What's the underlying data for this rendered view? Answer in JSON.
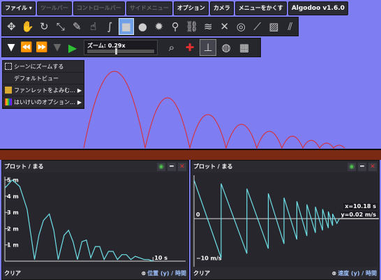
{
  "menubar": {
    "file": "ファイル ▾",
    "toolbar": "ツールバー",
    "control": "コントロールバー",
    "side": "サイドメニュー",
    "options": "オプション",
    "camera": "カメラ",
    "hide_menu": "メニューをかくす",
    "brand": "Algodoo v1.6.0"
  },
  "toolbar": {
    "tools": [
      "move-icon",
      "grab-icon",
      "rotate-icon",
      "scale-icon",
      "sketch-icon",
      "drag-icon",
      "rope-icon",
      "box-icon",
      "circle-icon",
      "gear-icon",
      "hinge-icon",
      "chain-icon",
      "spring-icon",
      "fixate-icon",
      "thruster-icon",
      "pen-icon",
      "texture-icon"
    ],
    "active_index": 7
  },
  "simbar": {
    "zoom_label": "ズーム: 0.29x",
    "zoom_level": 0.42
  },
  "leftmenu": {
    "items": [
      {
        "label": "シーンにズームする",
        "icon": "zoom-scene-icon",
        "arrow": ""
      },
      {
        "label": "デフォルトビュー",
        "icon": "",
        "arrow": ""
      },
      {
        "label": "ファンレットをよみむ...",
        "icon": "folder-icon",
        "arrow": "▶"
      },
      {
        "label": "はいけいのオプション...",
        "icon": "rainbow-icon",
        "arrow": "▶"
      }
    ]
  },
  "plot_left": {
    "title": "プロット / まる",
    "clear": "クリア",
    "axis_label": "位置 (y) / 時間",
    "y_ticks": [
      "5 m",
      "4 m",
      "3 m",
      "2 m",
      "1 m"
    ],
    "x_tick": "10 s",
    "chart_data": {
      "type": "line",
      "xlabel": "時間",
      "ylabel": "位置 (y)",
      "xlim": [
        0,
        12.2
      ],
      "ylim": [
        0,
        5.2
      ],
      "x": [
        0,
        0.5,
        1,
        1.5,
        2,
        2.3,
        2.6,
        3.0,
        3.3,
        3.6,
        4.0,
        4.3,
        4.6,
        4.9,
        5.2,
        5.5,
        5.8,
        6.1,
        6.4,
        6.7,
        7.0,
        7.3,
        7.6,
        7.9,
        8.2,
        8.5,
        8.8,
        9.1,
        9.4,
        9.7,
        10.0
      ],
      "y": [
        4.5,
        5.0,
        4.6,
        3.2,
        0.1,
        1.6,
        2.5,
        2.9,
        1.9,
        0.1,
        1.6,
        1.9,
        1.2,
        0.1,
        1.2,
        1.3,
        0.2,
        0.9,
        0.9,
        0.1,
        0.6,
        0.6,
        0.1,
        0.4,
        0.4,
        0.1,
        0.3,
        0.2,
        0.1,
        0.1,
        0.0
      ]
    }
  },
  "plot_right": {
    "title": "プロット / まる",
    "clear": "クリア",
    "axis_label": "速度 (y) / 時間",
    "y_zero": "0",
    "y_neg": "−10 m/s",
    "readout_x": "x=10.18 s",
    "readout_y": "y=0.02 m/s",
    "chart_data": {
      "type": "line",
      "xlabel": "時間",
      "ylabel": "速度 (y)",
      "xlim": [
        0,
        10.5
      ],
      "ylim": [
        -11.5,
        11
      ],
      "x": [
        0,
        1.9,
        1.9,
        3.7,
        3.7,
        5.2,
        5.2,
        6.3,
        6.3,
        7.2,
        7.2,
        7.9,
        7.9,
        8.5,
        8.5,
        9.0,
        9.0,
        9.4,
        9.4,
        9.7,
        9.7,
        10.0,
        10.18
      ],
      "y": [
        9.8,
        -10.0,
        8.9,
        -8.9,
        7.6,
        -7.6,
        6.4,
        -6.4,
        5.3,
        -5.3,
        4.4,
        -4.4,
        3.6,
        -3.6,
        3.0,
        -3.0,
        2.4,
        -2.4,
        1.8,
        -1.8,
        1.2,
        -1.2,
        0.02
      ]
    }
  },
  "colors": {
    "sky": "#7e7ef2",
    "trail": "#e02828",
    "ground": "#7a2a12",
    "plot_line": "#6fe0e8",
    "active_tool": "#6fa0e8"
  }
}
